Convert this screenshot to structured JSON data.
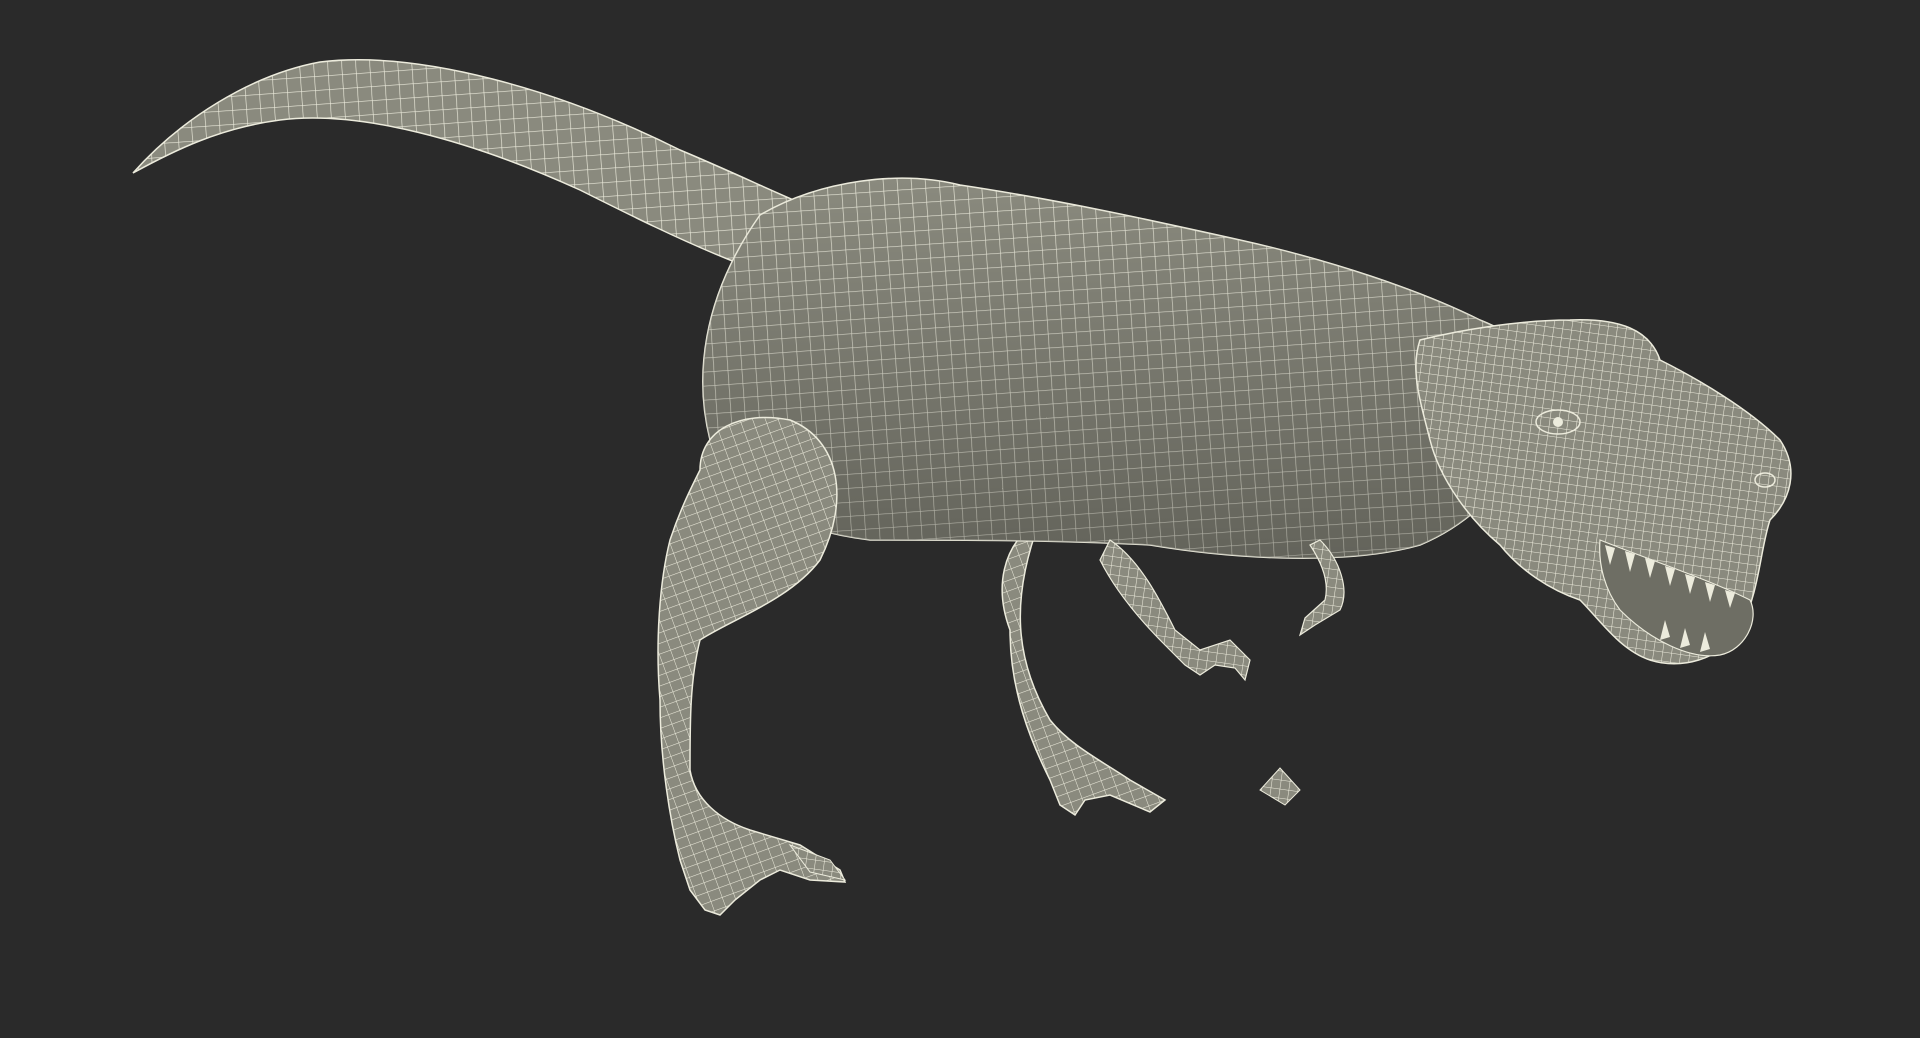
{
  "scene": {
    "background_color": "#2a2a2a",
    "mesh_fill_color": "#8a8a7e",
    "mesh_shadow_color": "#5f5f56",
    "wire_color": "#ecebdc",
    "subject_icon": "t-rex-wireframe-model"
  }
}
